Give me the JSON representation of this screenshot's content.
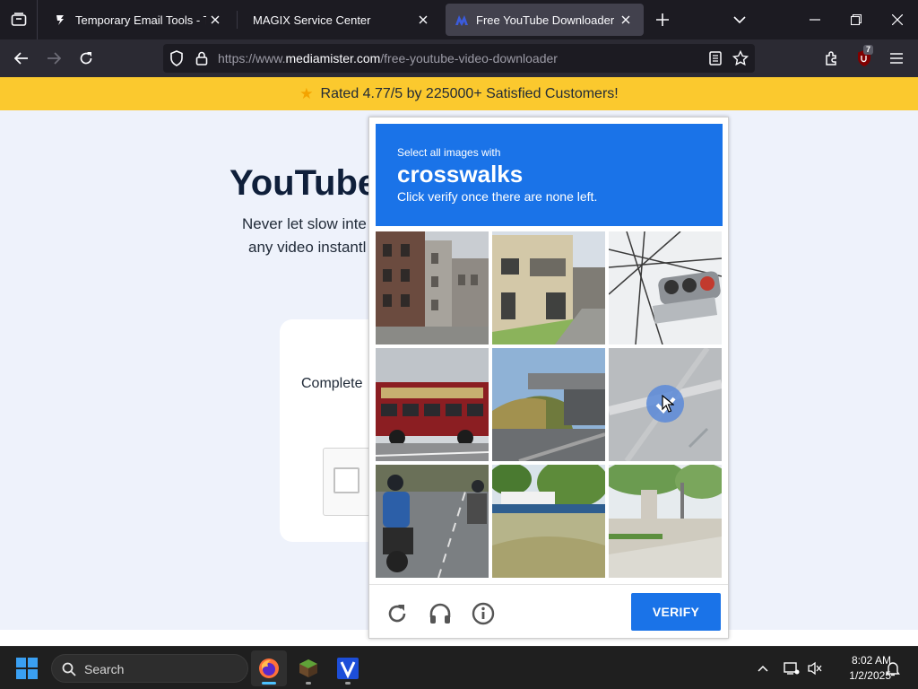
{
  "browser": {
    "tabs": [
      {
        "title": "Temporary Email Tools - Tempo",
        "active": false
      },
      {
        "title": "MAGIX Service Center",
        "active": false
      },
      {
        "title": "Free YouTube Downloader | Do",
        "active": true
      }
    ],
    "url_prefix": "https://www.",
    "url_domain": "mediamister.com",
    "url_path": "/free-youtube-video-downloader",
    "extension_badge": "7"
  },
  "page": {
    "rating_text": "Rated 4.77/5 by 225000+ Satisfied Customers!",
    "hero_title": "YouTube",
    "hero_sub_line1": "Never let slow inte",
    "hero_sub_line2": "any video instantl",
    "card_text": "Complete"
  },
  "captcha": {
    "instruction_line1": "Select all images with",
    "target": "crosswalks",
    "instruction_line3": "Click verify once there are none left.",
    "verify_label": "VERIFY",
    "header_color": "#1a73e8",
    "tiles": [
      {
        "name": "tile-buildings-street",
        "selected": false
      },
      {
        "name": "tile-house",
        "selected": false
      },
      {
        "name": "tile-traffic-light",
        "selected": false
      },
      {
        "name": "tile-bus",
        "selected": false
      },
      {
        "name": "tile-bridge",
        "selected": false
      },
      {
        "name": "tile-road-marking",
        "selected": true
      },
      {
        "name": "tile-motorcycle",
        "selected": false
      },
      {
        "name": "tile-park",
        "selected": false
      },
      {
        "name": "tile-sidewalk",
        "selected": false
      }
    ],
    "icons": [
      "reload-icon",
      "audio-challenge-icon",
      "info-icon"
    ]
  },
  "taskbar": {
    "search_label": "Search",
    "time": "8:02 AM",
    "date": "1/2/2025"
  }
}
